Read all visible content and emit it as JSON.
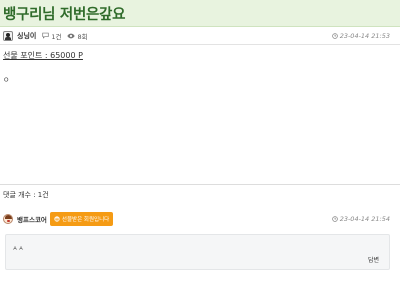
{
  "post": {
    "title": "뱅구리님 저번은갚요",
    "author": "싱닝이",
    "comment_count_short": "1건",
    "views": "8회",
    "date": "23-04-14 21:53",
    "gift_points": "선물 포인트 : 65000 P",
    "body": "ㅇ"
  },
  "comments_section": {
    "count_label": "댓글 개수 : 1건",
    "items": [
      {
        "author": "뱅프스코어",
        "badge": "선물받은 회원입니다",
        "date": "23-04-14 21:54",
        "text": "ㅅㅅ",
        "reply_label": "답변"
      }
    ]
  },
  "icons": {
    "author_avatar": "user-avatar-icon",
    "comment": "comment-bubble-icon",
    "views": "eye-icon",
    "date": "clock-icon",
    "badge": "gift-icon",
    "commenter_avatar": "commenter-avatar-icon"
  },
  "colors": {
    "title_bg": "#e8f3df",
    "title_text": "#2f6b2a",
    "badge_bg": "#f59b14",
    "comment_bg": "#f5f6f7"
  }
}
